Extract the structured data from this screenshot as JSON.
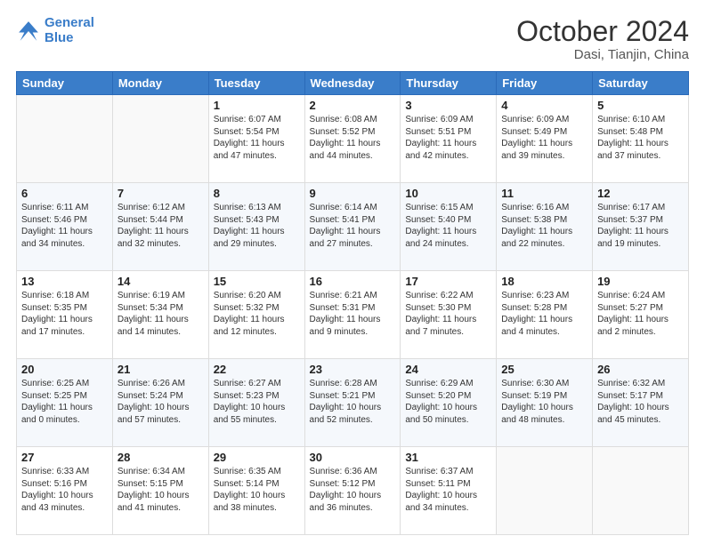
{
  "header": {
    "logo_line1": "General",
    "logo_line2": "Blue",
    "title": "October 2024",
    "subtitle": "Dasi, Tianjin, China"
  },
  "weekdays": [
    "Sunday",
    "Monday",
    "Tuesday",
    "Wednesday",
    "Thursday",
    "Friday",
    "Saturday"
  ],
  "weeks": [
    [
      {
        "day": "",
        "info": ""
      },
      {
        "day": "",
        "info": ""
      },
      {
        "day": "1",
        "info": "Sunrise: 6:07 AM\nSunset: 5:54 PM\nDaylight: 11 hours and 47 minutes."
      },
      {
        "day": "2",
        "info": "Sunrise: 6:08 AM\nSunset: 5:52 PM\nDaylight: 11 hours and 44 minutes."
      },
      {
        "day": "3",
        "info": "Sunrise: 6:09 AM\nSunset: 5:51 PM\nDaylight: 11 hours and 42 minutes."
      },
      {
        "day": "4",
        "info": "Sunrise: 6:09 AM\nSunset: 5:49 PM\nDaylight: 11 hours and 39 minutes."
      },
      {
        "day": "5",
        "info": "Sunrise: 6:10 AM\nSunset: 5:48 PM\nDaylight: 11 hours and 37 minutes."
      }
    ],
    [
      {
        "day": "6",
        "info": "Sunrise: 6:11 AM\nSunset: 5:46 PM\nDaylight: 11 hours and 34 minutes."
      },
      {
        "day": "7",
        "info": "Sunrise: 6:12 AM\nSunset: 5:44 PM\nDaylight: 11 hours and 32 minutes."
      },
      {
        "day": "8",
        "info": "Sunrise: 6:13 AM\nSunset: 5:43 PM\nDaylight: 11 hours and 29 minutes."
      },
      {
        "day": "9",
        "info": "Sunrise: 6:14 AM\nSunset: 5:41 PM\nDaylight: 11 hours and 27 minutes."
      },
      {
        "day": "10",
        "info": "Sunrise: 6:15 AM\nSunset: 5:40 PM\nDaylight: 11 hours and 24 minutes."
      },
      {
        "day": "11",
        "info": "Sunrise: 6:16 AM\nSunset: 5:38 PM\nDaylight: 11 hours and 22 minutes."
      },
      {
        "day": "12",
        "info": "Sunrise: 6:17 AM\nSunset: 5:37 PM\nDaylight: 11 hours and 19 minutes."
      }
    ],
    [
      {
        "day": "13",
        "info": "Sunrise: 6:18 AM\nSunset: 5:35 PM\nDaylight: 11 hours and 17 minutes."
      },
      {
        "day": "14",
        "info": "Sunrise: 6:19 AM\nSunset: 5:34 PM\nDaylight: 11 hours and 14 minutes."
      },
      {
        "day": "15",
        "info": "Sunrise: 6:20 AM\nSunset: 5:32 PM\nDaylight: 11 hours and 12 minutes."
      },
      {
        "day": "16",
        "info": "Sunrise: 6:21 AM\nSunset: 5:31 PM\nDaylight: 11 hours and 9 minutes."
      },
      {
        "day": "17",
        "info": "Sunrise: 6:22 AM\nSunset: 5:30 PM\nDaylight: 11 hours and 7 minutes."
      },
      {
        "day": "18",
        "info": "Sunrise: 6:23 AM\nSunset: 5:28 PM\nDaylight: 11 hours and 4 minutes."
      },
      {
        "day": "19",
        "info": "Sunrise: 6:24 AM\nSunset: 5:27 PM\nDaylight: 11 hours and 2 minutes."
      }
    ],
    [
      {
        "day": "20",
        "info": "Sunrise: 6:25 AM\nSunset: 5:25 PM\nDaylight: 11 hours and 0 minutes."
      },
      {
        "day": "21",
        "info": "Sunrise: 6:26 AM\nSunset: 5:24 PM\nDaylight: 10 hours and 57 minutes."
      },
      {
        "day": "22",
        "info": "Sunrise: 6:27 AM\nSunset: 5:23 PM\nDaylight: 10 hours and 55 minutes."
      },
      {
        "day": "23",
        "info": "Sunrise: 6:28 AM\nSunset: 5:21 PM\nDaylight: 10 hours and 52 minutes."
      },
      {
        "day": "24",
        "info": "Sunrise: 6:29 AM\nSunset: 5:20 PM\nDaylight: 10 hours and 50 minutes."
      },
      {
        "day": "25",
        "info": "Sunrise: 6:30 AM\nSunset: 5:19 PM\nDaylight: 10 hours and 48 minutes."
      },
      {
        "day": "26",
        "info": "Sunrise: 6:32 AM\nSunset: 5:17 PM\nDaylight: 10 hours and 45 minutes."
      }
    ],
    [
      {
        "day": "27",
        "info": "Sunrise: 6:33 AM\nSunset: 5:16 PM\nDaylight: 10 hours and 43 minutes."
      },
      {
        "day": "28",
        "info": "Sunrise: 6:34 AM\nSunset: 5:15 PM\nDaylight: 10 hours and 41 minutes."
      },
      {
        "day": "29",
        "info": "Sunrise: 6:35 AM\nSunset: 5:14 PM\nDaylight: 10 hours and 38 minutes."
      },
      {
        "day": "30",
        "info": "Sunrise: 6:36 AM\nSunset: 5:12 PM\nDaylight: 10 hours and 36 minutes."
      },
      {
        "day": "31",
        "info": "Sunrise: 6:37 AM\nSunset: 5:11 PM\nDaylight: 10 hours and 34 minutes."
      },
      {
        "day": "",
        "info": ""
      },
      {
        "day": "",
        "info": ""
      }
    ]
  ]
}
